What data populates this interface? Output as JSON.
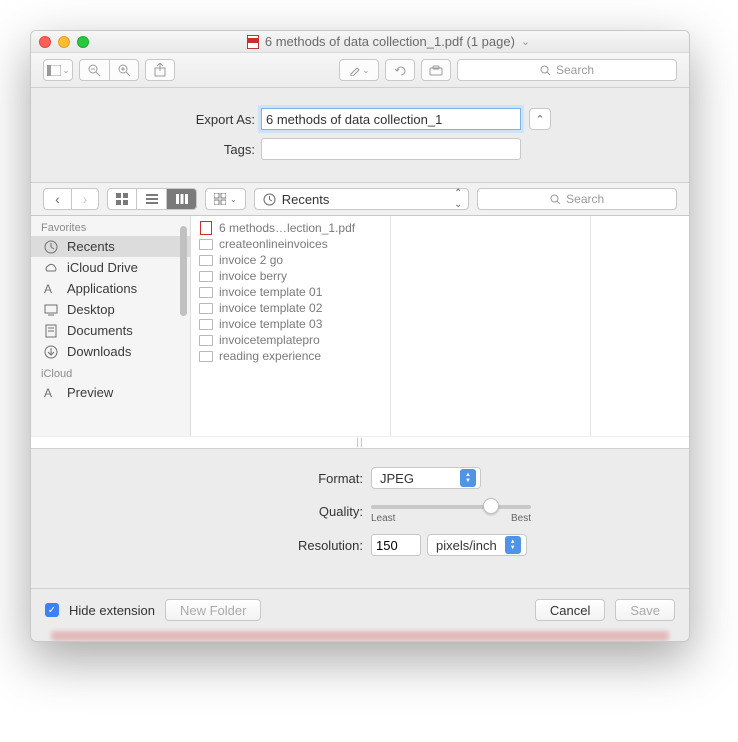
{
  "window": {
    "title": "6 methods of data collection_1.pdf (1 page)"
  },
  "toolbar": {
    "search_placeholder": "Search"
  },
  "fields": {
    "export_label": "Export As:",
    "export_value": "6 methods of data collection_1",
    "tags_label": "Tags:",
    "tags_value": ""
  },
  "browser": {
    "location": "Recents",
    "search_placeholder": "Search",
    "sidebar_groups": [
      {
        "header": "Favorites",
        "items": [
          {
            "label": "Recents",
            "icon": "clock",
            "selected": true
          },
          {
            "label": "iCloud Drive",
            "icon": "cloud"
          },
          {
            "label": "Applications",
            "icon": "apps"
          },
          {
            "label": "Desktop",
            "icon": "desktop"
          },
          {
            "label": "Documents",
            "icon": "doc"
          },
          {
            "label": "Downloads",
            "icon": "down"
          }
        ]
      },
      {
        "header": "iCloud",
        "items": [
          {
            "label": "Preview",
            "icon": "apps"
          }
        ]
      }
    ],
    "column_items": [
      {
        "label": "6 methods…lection_1.pdf",
        "type": "pdf"
      },
      {
        "label": "createonlineinvoices",
        "type": "folder"
      },
      {
        "label": "invoice 2 go",
        "type": "folder"
      },
      {
        "label": "invoice berry",
        "type": "folder"
      },
      {
        "label": "invoice template 01",
        "type": "folder"
      },
      {
        "label": "invoice template 02",
        "type": "folder"
      },
      {
        "label": "invoice template 03",
        "type": "folder"
      },
      {
        "label": "invoicetemplatepro",
        "type": "folder"
      },
      {
        "label": "reading experience",
        "type": "folder"
      }
    ]
  },
  "options": {
    "format_label": "Format:",
    "format_value": "JPEG",
    "quality_label": "Quality:",
    "quality_least": "Least",
    "quality_best": "Best",
    "resolution_label": "Resolution:",
    "resolution_value": "150",
    "resolution_unit": "pixels/inch"
  },
  "bottom": {
    "hide_ext": "Hide extension",
    "new_folder": "New Folder",
    "cancel": "Cancel",
    "save": "Save"
  }
}
